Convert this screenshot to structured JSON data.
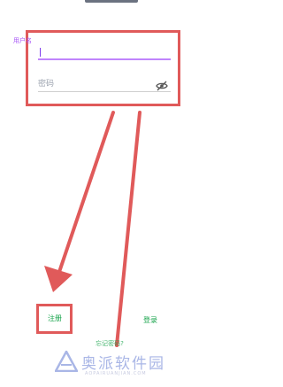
{
  "form": {
    "username_label": "用户名",
    "username_value": "",
    "password_placeholder": "密码",
    "eye_icon": "eye-off-icon"
  },
  "actions": {
    "register_label": "注册",
    "login_label": "登录",
    "forgot_label": "忘记密码?"
  },
  "annotations": {
    "highlight_color": "#e05a5a",
    "arrow_color": "#e05a5a"
  },
  "watermark": {
    "title": "奥派软件园",
    "url": "AOPAIRUANJIAN.COM"
  },
  "colors": {
    "accent_purple": "#a855f7",
    "link_green": "#16a34a"
  }
}
